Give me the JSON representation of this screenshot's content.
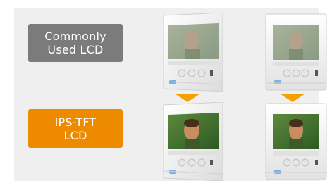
{
  "labels": {
    "common": [
      "Commonly",
      "Used LCD"
    ],
    "ips": [
      "IPS-TFT",
      "LCD"
    ]
  },
  "colors": {
    "panel_bg": "#efefef",
    "common_bg": "#7b7b7b",
    "ips_bg": "#ee8a00",
    "arrow": "#f2a100"
  },
  "devices": [
    {
      "row": "common",
      "view": "angled",
      "screen_tint": "washed"
    },
    {
      "row": "common",
      "view": "front",
      "screen_tint": "washed"
    },
    {
      "row": "ips",
      "view": "angled",
      "screen_tint": "vivid"
    },
    {
      "row": "ips",
      "view": "front",
      "screen_tint": "vivid"
    }
  ]
}
